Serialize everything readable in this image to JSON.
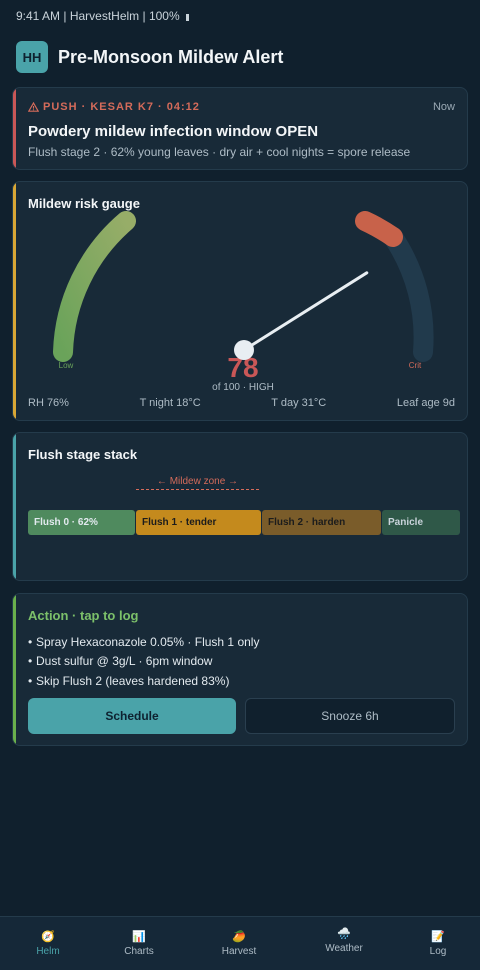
{
  "status_bar": {
    "text": "9:41 AM | HarvestHelm | 100%"
  },
  "header": {
    "logo": "HH",
    "title": "Pre-Monsoon Mildew Alert"
  },
  "push": {
    "label": "PUSH · KESAR K7 · 04:12",
    "time": "Now",
    "title": "Powdery mildew infection window OPEN",
    "body": "Flush stage 2 · 62% young leaves · dry air + cool nights = spore release",
    "icon": "warning-icon",
    "accent": "#c95757"
  },
  "gauge": {
    "title": "Mildew risk gauge",
    "value": "78",
    "value_number": 78,
    "max": 100,
    "caption": "of 100 · HIGH",
    "low_label": "Low",
    "crit_label": "Crit",
    "stats": [
      "RH 76%",
      "T night 18°C",
      "T day 31°C",
      "Leaf age 9d"
    ]
  },
  "flush": {
    "title": "Flush stage stack",
    "zone_label": "← Mildew zone →",
    "segments": [
      {
        "label": "Flush 0 · 62%",
        "color": "#4f8a5e",
        "text_color": "#e3eaef"
      },
      {
        "label": "Flush 1 · tender",
        "color": "#c48a1d",
        "text_color": "#1c1c1c"
      },
      {
        "label": "Flush 2 · harden",
        "color": "#7a5c2a",
        "text_color": "#1c1c1c"
      },
      {
        "label": "Panicle",
        "color": "#2f5848",
        "text_color": "#c9d3da"
      }
    ]
  },
  "action": {
    "title": "Action · tap to log",
    "items": [
      "Spray Hexaconazole 0.05% · Flush 1 only",
      "Dust sulfur @ 3g/L · 6pm window",
      "Skip Flush 2 (leaves hardened 83%)"
    ],
    "primary_label": "Schedule",
    "secondary_label": "Snooze 6h"
  },
  "tabs": [
    {
      "label": "Helm",
      "icon": "compass-icon",
      "glyph": "🧭",
      "active": true
    },
    {
      "label": "Charts",
      "icon": "chart-icon",
      "glyph": "📊",
      "active": false
    },
    {
      "label": "Harvest",
      "icon": "mango-icon",
      "glyph": "🥭",
      "active": false
    },
    {
      "label": "Weather",
      "icon": "rain-cloud-icon",
      "glyph": "🌧️",
      "active": false
    },
    {
      "label": "Log",
      "icon": "memo-icon",
      "glyph": "📝",
      "active": false
    }
  ]
}
